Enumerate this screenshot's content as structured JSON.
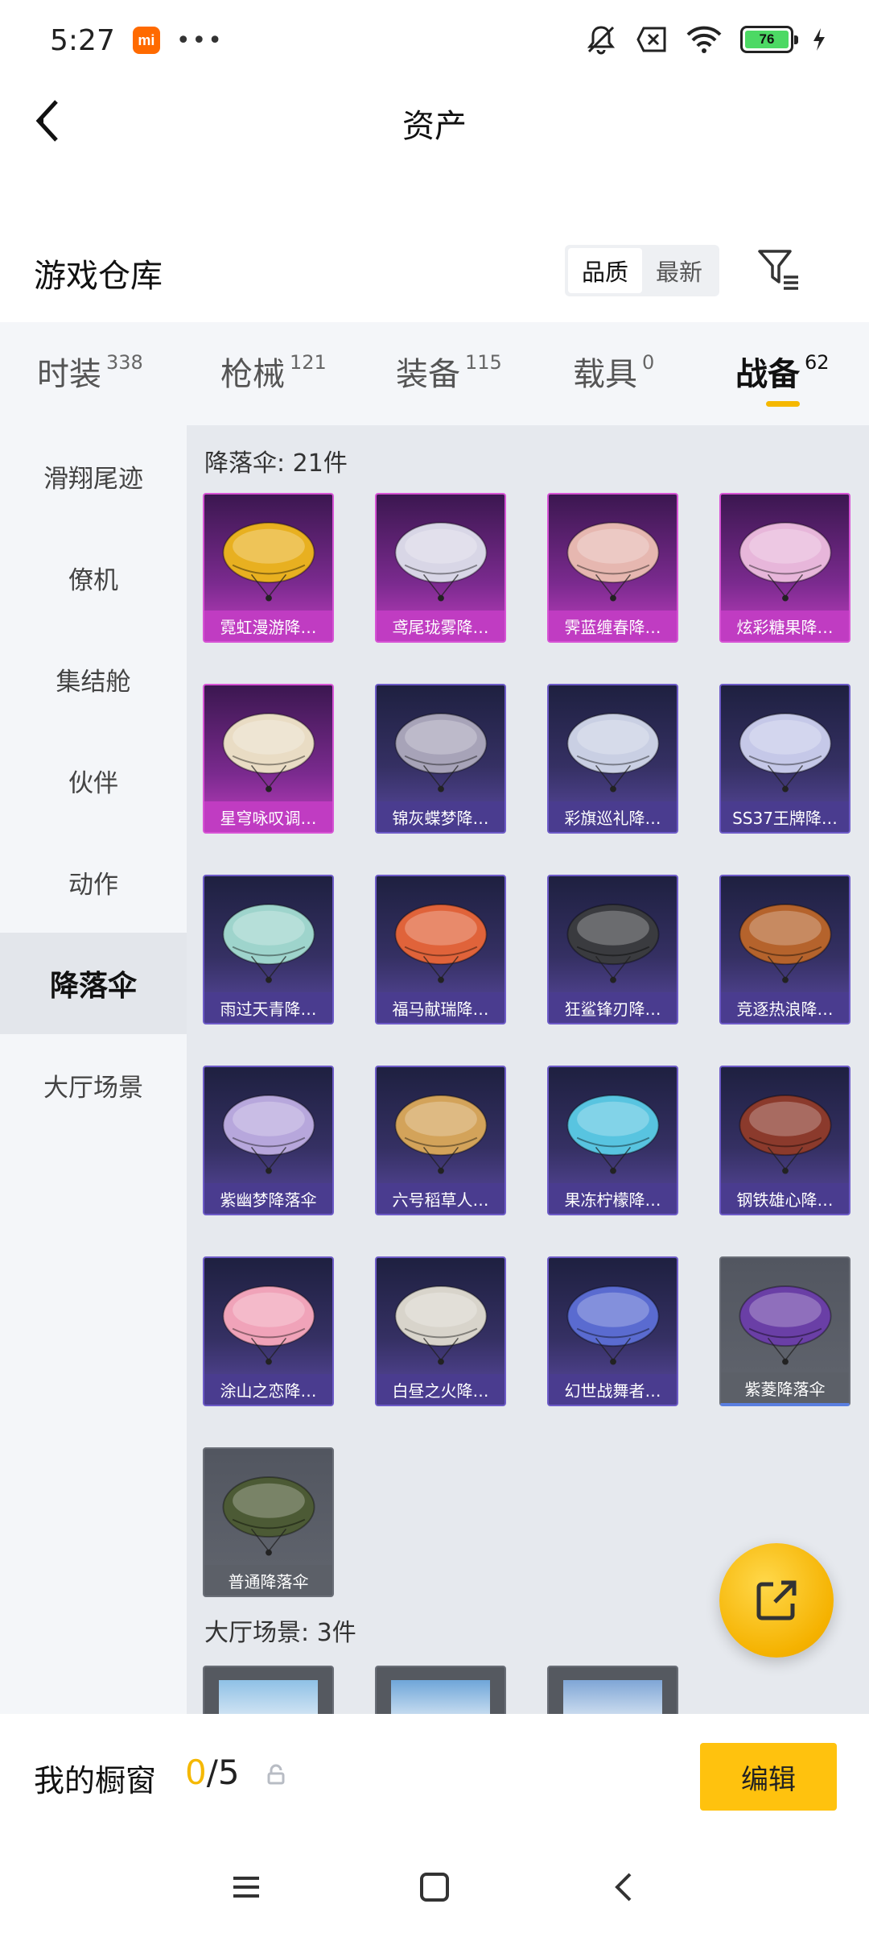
{
  "status_bar": {
    "time": "5:27",
    "mi_badge": "mi",
    "dots": "•••",
    "battery": "76",
    "icons": [
      "mute-icon",
      "sim-off-icon",
      "wifi-icon",
      "battery-icon",
      "charging-icon"
    ]
  },
  "header": {
    "title": "资产"
  },
  "warehouse": {
    "title": "游戏仓库",
    "sort_options": [
      "品质",
      "最新"
    ],
    "active_sort": "品质"
  },
  "tabs": [
    {
      "label": "时装",
      "count": "338"
    },
    {
      "label": "枪械",
      "count": "121"
    },
    {
      "label": "装备",
      "count": "115"
    },
    {
      "label": "载具",
      "count": "0"
    },
    {
      "label": "战备",
      "count": "62",
      "active": true
    }
  ],
  "side_menu": [
    {
      "label": "滑翔尾迹"
    },
    {
      "label": "僚机"
    },
    {
      "label": "集结舱"
    },
    {
      "label": "伙伴"
    },
    {
      "label": "动作"
    },
    {
      "label": "降落伞",
      "active": true
    },
    {
      "label": "大厅场景"
    }
  ],
  "sections": {
    "parachute_label": "降落伞: 21件",
    "lobby_label": "大厅场景: 3件"
  },
  "items": [
    {
      "name": "霓虹漫游降…",
      "rarity": "legend",
      "color": "#e8b020"
    },
    {
      "name": "鸢尾珑雾降…",
      "rarity": "legend",
      "color": "#d8d6e6"
    },
    {
      "name": "霁蓝缠春降…",
      "rarity": "legend",
      "color": "#e6b7b0"
    },
    {
      "name": "炫彩糖果降…",
      "rarity": "legend",
      "color": "#e7b6da"
    },
    {
      "name": "星穹咏叹调…",
      "rarity": "legend",
      "color": "#e9dcc4"
    },
    {
      "name": "锦灰蝶梦降…",
      "rarity": "epic",
      "color": "#a7a3b8"
    },
    {
      "name": "彩旗巡礼降…",
      "rarity": "epic",
      "color": "#c9cfe3"
    },
    {
      "name": "SS37王牌降…",
      "rarity": "epic",
      "color": "#c5c8e8"
    },
    {
      "name": "雨过天青降…",
      "rarity": "epic",
      "color": "#9ed4cc"
    },
    {
      "name": "福马献瑞降…",
      "rarity": "epic",
      "color": "#e0633a"
    },
    {
      "name": "狂鲨锋刃降…",
      "rarity": "epic",
      "color": "#3a3b3f"
    },
    {
      "name": "竞逐热浪降…",
      "rarity": "epic",
      "color": "#b5632c"
    },
    {
      "name": "紫幽梦降落伞",
      "rarity": "epic",
      "color": "#b7a7dc"
    },
    {
      "name": "六号稻草人…",
      "rarity": "epic",
      "color": "#d3a35a"
    },
    {
      "name": "果冻柠檬降…",
      "rarity": "epic",
      "color": "#58c4e0"
    },
    {
      "name": "钢铁雄心降…",
      "rarity": "epic",
      "color": "#8b3a2c"
    },
    {
      "name": "涂山之恋降…",
      "rarity": "epic",
      "color": "#f0a3b9"
    },
    {
      "name": "白昼之火降…",
      "rarity": "epic",
      "color": "#d8d4cb"
    },
    {
      "name": "幻世战舞者…",
      "rarity": "epic",
      "color": "#5a6bd0"
    },
    {
      "name": "紫菱降落伞",
      "rarity": "rare-blue",
      "color": "#6a3fa6"
    },
    {
      "name": "普通降落伞",
      "rarity": "rare",
      "color": "#4c5a35"
    }
  ],
  "scenes": [
    {
      "color": "#8fc1e6"
    },
    {
      "color": "#6fa6d9"
    },
    {
      "color": "#7fa6d6"
    }
  ],
  "showcase": {
    "title": "我的橱窗",
    "current": "0",
    "total": "/5",
    "edit_label": "编辑"
  },
  "accent_color": "#f5b800"
}
